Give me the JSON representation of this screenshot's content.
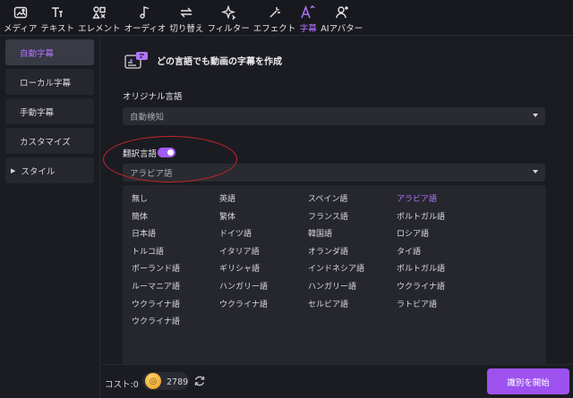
{
  "toolbar": {
    "items": [
      {
        "label": "メディア",
        "icon": "media-icon"
      },
      {
        "label": "テキスト",
        "icon": "text-icon"
      },
      {
        "label": "エレメント",
        "icon": "elements-icon"
      },
      {
        "label": "オーディオ",
        "icon": "audio-icon"
      },
      {
        "label": "切り替え",
        "icon": "transition-icon"
      },
      {
        "label": "フィルター",
        "icon": "filter-icon"
      },
      {
        "label": "エフェクト",
        "icon": "effect-icon"
      },
      {
        "label": "字幕",
        "icon": "subtitle-icon",
        "active": true
      },
      {
        "label": "AIアバター",
        "icon": "ai-avatar-icon"
      }
    ]
  },
  "sidebar": {
    "items": [
      {
        "label": "自動字幕",
        "active": true
      },
      {
        "label": "ローカル字幕"
      },
      {
        "label": "手動字幕"
      },
      {
        "label": "カスタマイズ"
      },
      {
        "label": "スタイル",
        "collapsible": true
      }
    ]
  },
  "main": {
    "header": "どの言語でも動画の字幕を作成",
    "original_language": {
      "label": "オリジナル言語",
      "value": "自動検知"
    },
    "translation": {
      "label": "翻訳言語",
      "enabled": true,
      "value": "アラビア語"
    },
    "languages": [
      [
        "無し",
        "英語",
        "スペイン語",
        "アラビア語"
      ],
      [
        "簡体",
        "繁体",
        "フランス語",
        "ポルトガル語"
      ],
      [
        "日本語",
        "ドイツ語",
        "韓国語",
        "ロシア語"
      ],
      [
        "トルコ語",
        "イタリア語",
        "オランダ語",
        "タイ語"
      ],
      [
        "ポーランド語",
        "ギリシャ語",
        "インドネシア語",
        "ポルトガル語"
      ],
      [
        "ルーマニア語",
        "ハンガリー語",
        "ハンガリー語",
        "ウクライナ語"
      ],
      [
        "ウクライナ語",
        "ウクライナ語",
        "セルビア語",
        "ラトビア語"
      ],
      [
        "ウクライナ語"
      ]
    ],
    "selected_language": "アラビア語"
  },
  "footer": {
    "cost_label": "コスト:0",
    "credits": "2789",
    "start_label": "識別を開始"
  },
  "colors": {
    "accent": "#b174ff",
    "button": "#9d52f0",
    "highlight_ellipse": "#c7242b"
  }
}
